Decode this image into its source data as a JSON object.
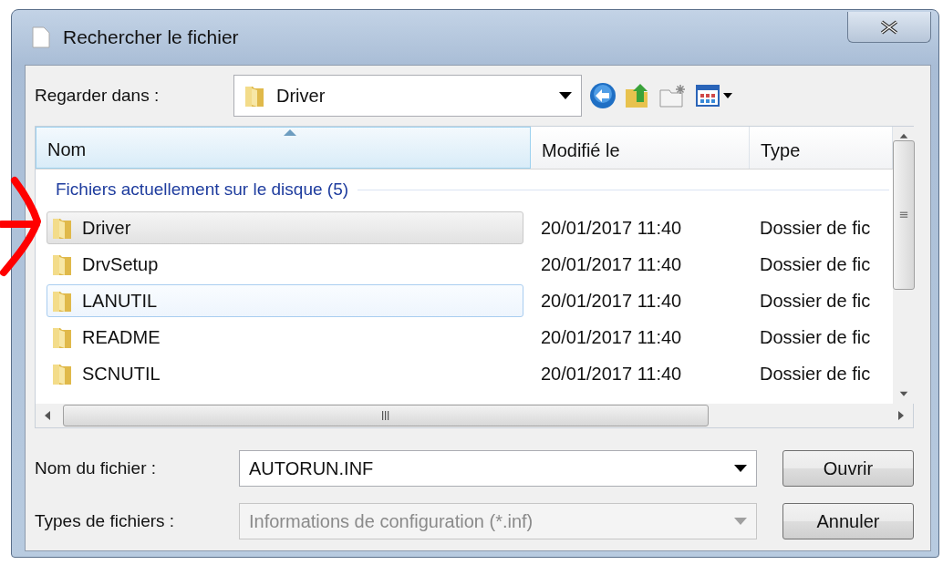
{
  "window": {
    "title": "Rechercher le fichier"
  },
  "look_in": {
    "label": "Regarder dans :",
    "value": "Driver"
  },
  "file_list": {
    "columns": [
      {
        "label": "Nom",
        "sorted": true
      },
      {
        "label": "Modifié le",
        "sorted": false
      },
      {
        "label": "Type",
        "sorted": false
      }
    ],
    "group": "Fichiers actuellement sur le disque (5)",
    "rows": [
      {
        "name": "Driver",
        "modified": "20/01/2017 11:40",
        "type": "Dossier de fic",
        "selected": true,
        "focused": false
      },
      {
        "name": "DrvSetup",
        "modified": "20/01/2017 11:40",
        "type": "Dossier de fic",
        "selected": false,
        "focused": false
      },
      {
        "name": "LANUTIL",
        "modified": "20/01/2017 11:40",
        "type": "Dossier de fic",
        "selected": false,
        "focused": true
      },
      {
        "name": "README",
        "modified": "20/01/2017 11:40",
        "type": "Dossier de fic",
        "selected": false,
        "focused": false
      },
      {
        "name": "SCNUTIL",
        "modified": "20/01/2017 11:40",
        "type": "Dossier de fic",
        "selected": false,
        "focused": false
      }
    ]
  },
  "file_name": {
    "label": "Nom du fichier :",
    "value": "AUTORUN.INF"
  },
  "file_types": {
    "label": "Types de fichiers :",
    "value": "Informations de configuration (*.inf)",
    "disabled": true
  },
  "buttons": [
    "Ouvrir",
    "Annuler"
  ]
}
